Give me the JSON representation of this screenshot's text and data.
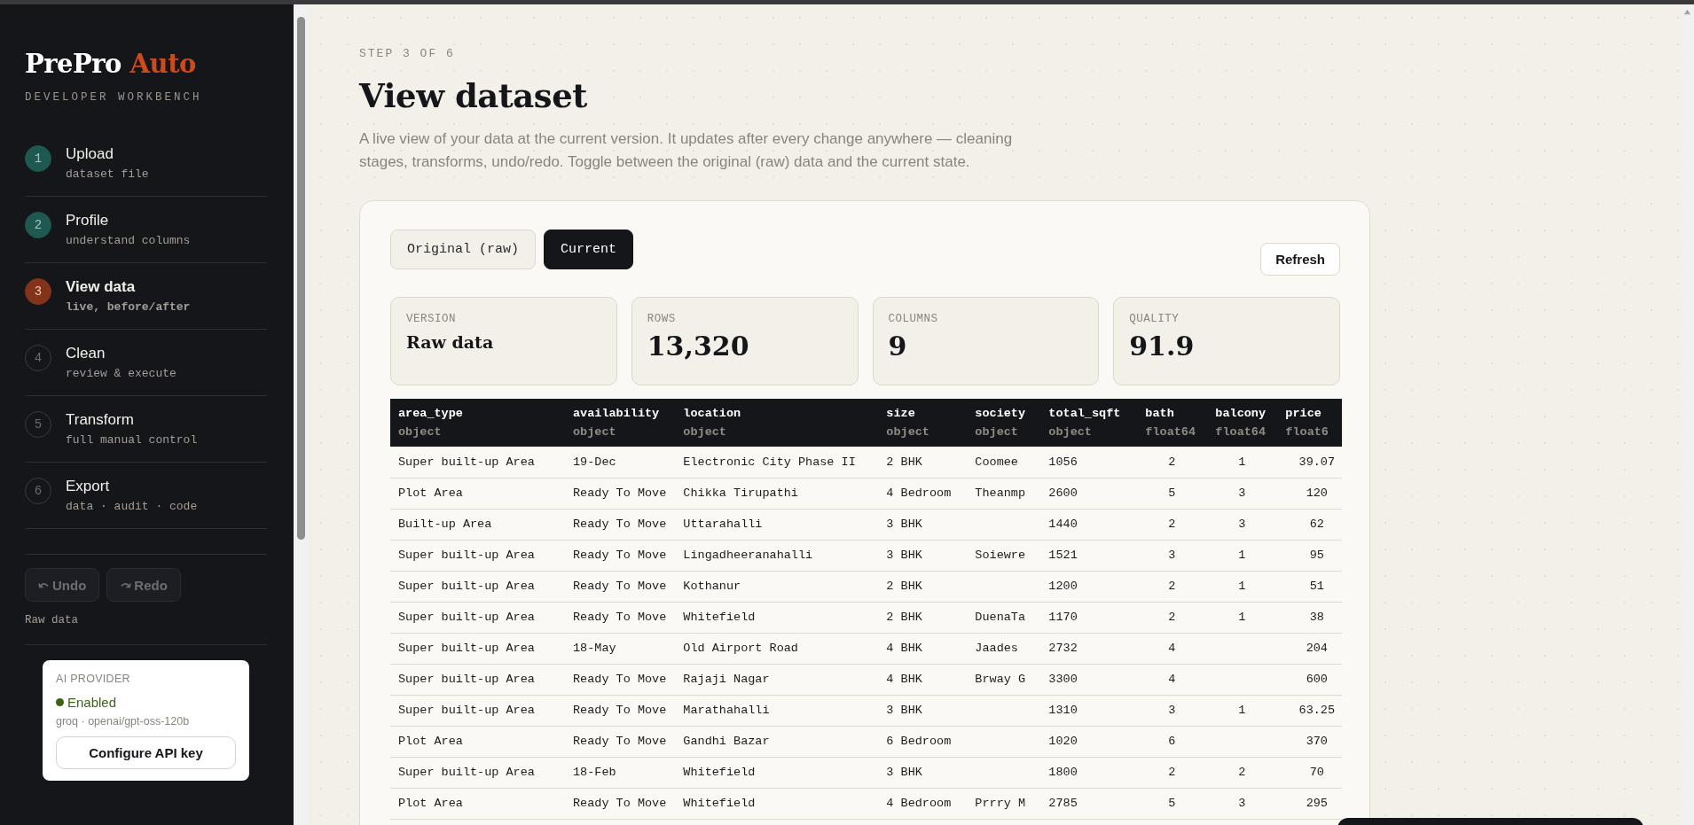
{
  "brand": {
    "name": "PrePro",
    "accent": "Auto",
    "tagline": "DEVELOPER WORKBENCH"
  },
  "steps": [
    {
      "number": "1",
      "title": "Upload",
      "subtitle": "dataset file",
      "completed": true,
      "selected": false
    },
    {
      "number": "2",
      "title": "Profile",
      "subtitle": "understand columns",
      "completed": true,
      "selected": false
    },
    {
      "number": "3",
      "title": "View data",
      "subtitle": "live, before/after",
      "completed": false,
      "selected": true
    },
    {
      "number": "4",
      "title": "Clean",
      "subtitle": "review & execute",
      "completed": false,
      "selected": false
    },
    {
      "number": "5",
      "title": "Transform",
      "subtitle": "full manual control",
      "completed": false,
      "selected": false
    },
    {
      "number": "6",
      "title": "Export",
      "subtitle": "data · audit · code",
      "completed": false,
      "selected": false
    }
  ],
  "history": {
    "undo": {
      "label": "Undo",
      "disabled": true
    },
    "redo": {
      "label": "Redo",
      "disabled": true
    },
    "version": "Raw data"
  },
  "ai_provider": {
    "heading": "AI PROVIDER",
    "status": "Enabled",
    "color": "#3f5f1a",
    "model": "groq · openai/gpt-oss-120b",
    "button": "Configure API key"
  },
  "page": {
    "step": "STEP 3 OF 6",
    "title": "View dataset",
    "description": "A live view of your data at the current version. It updates after every change anywhere — cleaning stages, transforms, undo/redo. Toggle between the original (raw) data and the current state."
  },
  "view_tabs": [
    {
      "label": "Original (raw)",
      "selected": false
    },
    {
      "label": "Current",
      "selected": true
    }
  ],
  "refresh_button": "Refresh",
  "stats": [
    {
      "label": "VERSION",
      "value": "Raw data",
      "kind": "text"
    },
    {
      "label": "ROWS",
      "value": "13,320",
      "kind": "number"
    },
    {
      "label": "COLUMNS",
      "value": "9",
      "kind": "number"
    },
    {
      "label": "QUALITY",
      "value": "91.9",
      "kind": "number"
    }
  ],
  "table": {
    "columns": [
      {
        "name": "area_type",
        "dtype": "object"
      },
      {
        "name": "availability",
        "dtype": "object"
      },
      {
        "name": "location",
        "dtype": "object"
      },
      {
        "name": "size",
        "dtype": "object"
      },
      {
        "name": "society",
        "dtype": "object"
      },
      {
        "name": "total_sqft",
        "dtype": "object"
      },
      {
        "name": "bath",
        "dtype": "float64"
      },
      {
        "name": "balcony",
        "dtype": "float64"
      },
      {
        "name": "price",
        "dtype": "float6"
      }
    ],
    "rows": [
      [
        "Super built-up Area",
        "19-Dec",
        "Electronic City Phase II",
        "2 BHK",
        "Coomee",
        "1056",
        "2",
        "1",
        "39.07"
      ],
      [
        "Plot Area",
        "Ready To Move",
        "Chikka Tirupathi",
        "4 Bedroom",
        "Theanmp",
        "2600",
        "5",
        "3",
        "120"
      ],
      [
        "Built-up Area",
        "Ready To Move",
        "Uttarahalli",
        "3 BHK",
        "",
        "1440",
        "2",
        "3",
        "62"
      ],
      [
        "Super built-up Area",
        "Ready To Move",
        "Lingadheeranahalli",
        "3 BHK",
        "Soiewre",
        "1521",
        "3",
        "1",
        "95"
      ],
      [
        "Super built-up Area",
        "Ready To Move",
        "Kothanur",
        "2 BHK",
        "",
        "1200",
        "2",
        "1",
        "51"
      ],
      [
        "Super built-up Area",
        "Ready To Move",
        "Whitefield",
        "2 BHK",
        "DuenaTa",
        "1170",
        "2",
        "1",
        "38"
      ],
      [
        "Super built-up Area",
        "18-May",
        "Old Airport Road",
        "4 BHK",
        "Jaades",
        "2732",
        "4",
        "",
        "204"
      ],
      [
        "Super built-up Area",
        "Ready To Move",
        "Rajaji Nagar",
        "4 BHK",
        "Brway G",
        "3300",
        "4",
        "",
        "600"
      ],
      [
        "Super built-up Area",
        "Ready To Move",
        "Marathahalli",
        "3 BHK",
        "",
        "1310",
        "3",
        "1",
        "63.25"
      ],
      [
        "Plot Area",
        "Ready To Move",
        "Gandhi Bazar",
        "6 Bedroom",
        "",
        "1020",
        "6",
        "",
        "370"
      ],
      [
        "Super built-up Area",
        "18-Feb",
        "Whitefield",
        "3 BHK",
        "",
        "1800",
        "2",
        "2",
        "70"
      ],
      [
        "Plot Area",
        "Ready To Move",
        "Whitefield",
        "4 Bedroom",
        "Prrry M",
        "2785",
        "5",
        "3",
        "295"
      ]
    ]
  }
}
